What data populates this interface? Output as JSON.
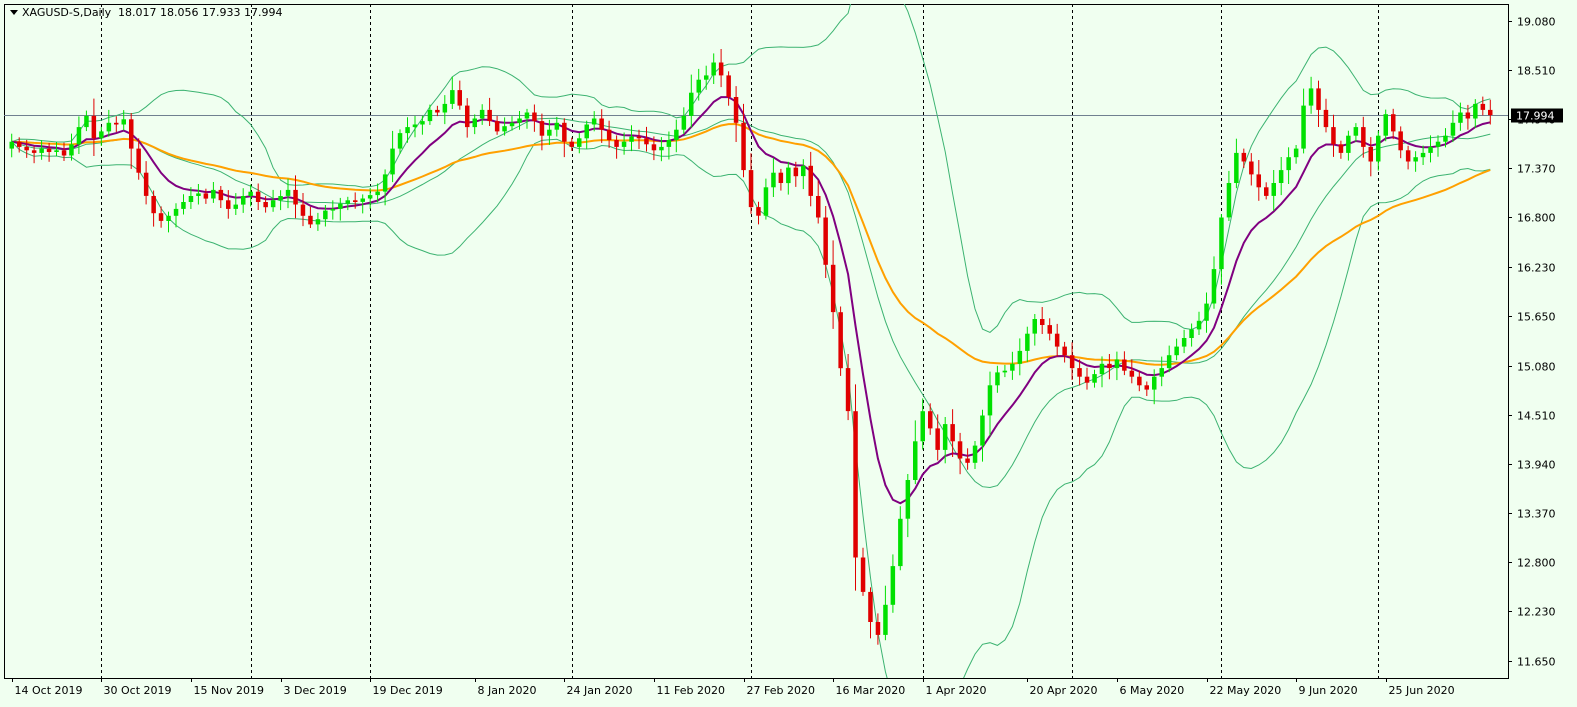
{
  "chart_data": {
    "type": "candlestick",
    "symbol_header": "XAGUSD-S,Daily",
    "ohlc_header": "18.017 18.056 17.933 17.994",
    "current_price": 17.994,
    "current_price_label": "17.994",
    "ylim": [
      11.45,
      19.28
    ],
    "y_ticks": [
      19.08,
      18.51,
      17.94,
      17.37,
      16.8,
      16.23,
      15.65,
      15.08,
      14.51,
      13.94,
      13.37,
      12.8,
      12.23,
      11.65
    ],
    "y_tick_labels": [
      "19.080",
      "18.510",
      "17.940",
      "17.370",
      "16.800",
      "16.230",
      "15.650",
      "15.080",
      "14.510",
      "13.940",
      "13.370",
      "12.800",
      "12.230",
      "11.650"
    ],
    "x_labels": [
      "14 Oct 2019",
      "30 Oct 2019",
      "15 Nov 2019",
      "3 Dec 2019",
      "19 Dec 2019",
      "8 Jan 2020",
      "24 Jan 2020",
      "11 Feb 2020",
      "27 Feb 2020",
      "16 Mar 2020",
      "1 Apr 2020",
      "20 Apr 2020",
      "6 May 2020",
      "22 May 2020",
      "9 Jun 2020",
      "25 Jun 2020"
    ],
    "x_label_bar_index": [
      0,
      12,
      24,
      36,
      48,
      62,
      74,
      86,
      98,
      110,
      122,
      136,
      148,
      160,
      172,
      184
    ],
    "separator_bar_index": [
      12,
      32,
      48,
      75,
      99,
      122,
      142,
      162,
      183
    ],
    "colors": {
      "background": "#f0fff0",
      "bull": "#00e000",
      "bear": "#e00000",
      "ma_fast": "#800080",
      "ma_slow": "#ffa000",
      "bands": "#3cb371",
      "price_line": "#708090"
    },
    "closes": [
      17.68,
      17.62,
      17.58,
      17.55,
      17.6,
      17.56,
      17.58,
      17.52,
      17.65,
      17.85,
      17.98,
      17.72,
      17.8,
      17.9,
      17.88,
      17.94,
      17.6,
      17.32,
      17.05,
      16.85,
      16.76,
      16.82,
      16.9,
      16.98,
      17.05,
      17.08,
      17.02,
      17.12,
      17.0,
      16.9,
      16.95,
      17.05,
      17.1,
      16.98,
      16.92,
      17.0,
      17.05,
      17.12,
      16.95,
      16.82,
      16.72,
      16.78,
      16.88,
      16.9,
      16.96,
      17.0,
      16.98,
      17.02,
      17.06,
      17.1,
      17.3,
      17.6,
      17.78,
      17.85,
      17.88,
      17.92,
      18.05,
      18.02,
      18.12,
      18.28,
      18.1,
      17.85,
      17.95,
      18.05,
      17.92,
      17.8,
      17.86,
      17.9,
      17.95,
      18.02,
      17.92,
      17.75,
      17.82,
      17.9,
      17.68,
      17.62,
      17.72,
      17.88,
      17.95,
      17.82,
      17.7,
      17.62,
      17.68,
      17.74,
      17.72,
      17.65,
      17.58,
      17.62,
      17.7,
      17.82,
      17.98,
      18.25,
      18.4,
      18.45,
      18.6,
      18.45,
      18.2,
      17.9,
      17.35,
      16.92,
      16.82,
      17.15,
      17.32,
      17.2,
      17.38,
      17.28,
      17.4,
      17.05,
      16.8,
      16.25,
      15.7,
      15.05,
      14.55,
      12.85,
      12.45,
      12.1,
      11.95,
      12.3,
      12.75,
      13.3,
      13.75,
      14.2,
      14.55,
      14.35,
      14.1,
      14.4,
      14.2,
      14.0,
      13.95,
      14.15,
      14.5,
      14.85,
      15.0,
      15.02,
      15.1,
      15.25,
      15.45,
      15.62,
      15.55,
      15.45,
      15.3,
      15.2,
      15.05,
      14.95,
      14.88,
      14.98,
      15.1,
      15.05,
      15.15,
      15.02,
      14.95,
      14.85,
      14.8,
      14.95,
      15.05,
      15.2,
      15.3,
      15.4,
      15.5,
      15.6,
      15.8,
      16.2,
      16.8,
      17.2,
      17.55,
      17.45,
      17.3,
      17.15,
      17.05,
      17.2,
      17.35,
      17.5,
      17.6,
      18.1,
      18.3,
      18.05,
      17.85,
      17.65,
      17.55,
      17.75,
      17.85,
      17.62,
      17.45,
      17.75,
      18.0,
      17.8,
      17.58,
      17.45,
      17.5,
      17.55,
      17.62,
      17.68,
      17.75,
      17.9,
      18.02,
      17.95,
      18.12,
      18.05,
      17.99
    ]
  }
}
